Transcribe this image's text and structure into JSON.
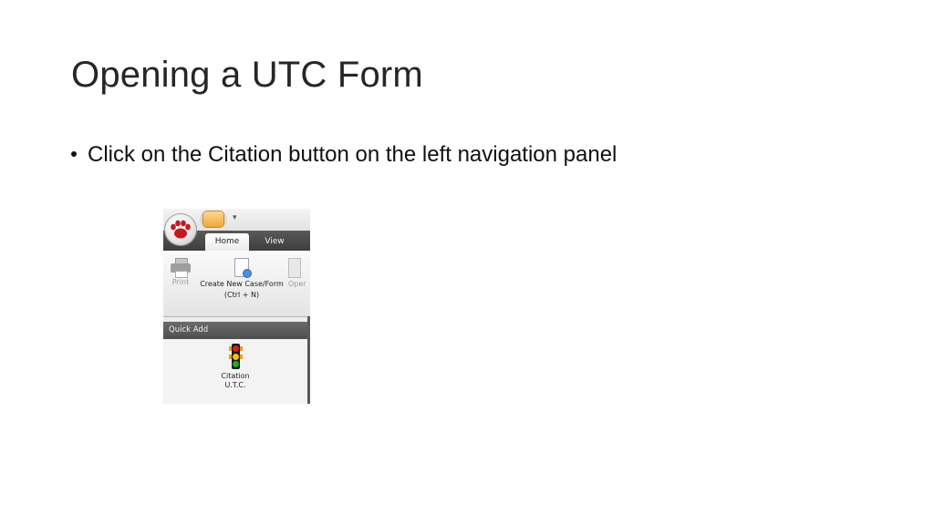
{
  "slide": {
    "title": "Opening a UTC Form",
    "bullet": "Click on the Citation button on the left navigation panel"
  },
  "app": {
    "qat_icons": [
      "app-orb-paw-icon",
      "quick-access-icon",
      "customize-arrow-icon"
    ],
    "tabs": [
      {
        "label": "Home",
        "selected": true
      },
      {
        "label": "View",
        "selected": false
      }
    ],
    "ribbon": {
      "print_label": "Print",
      "create_label_line1": "Create New Case/Form",
      "create_label_line2": "(Ctrl + N)",
      "open_label": "Oper"
    },
    "quick_add": {
      "header": "Quick Add",
      "citation_line1": "Citation",
      "citation_line2": "U.T.C."
    }
  },
  "colors": {
    "paw_red": "#c8161d",
    "tab_strip": "#4a4a4a",
    "light_red": "#d42020",
    "light_yellow": "#e8c21a",
    "light_green": "#23a53a"
  }
}
